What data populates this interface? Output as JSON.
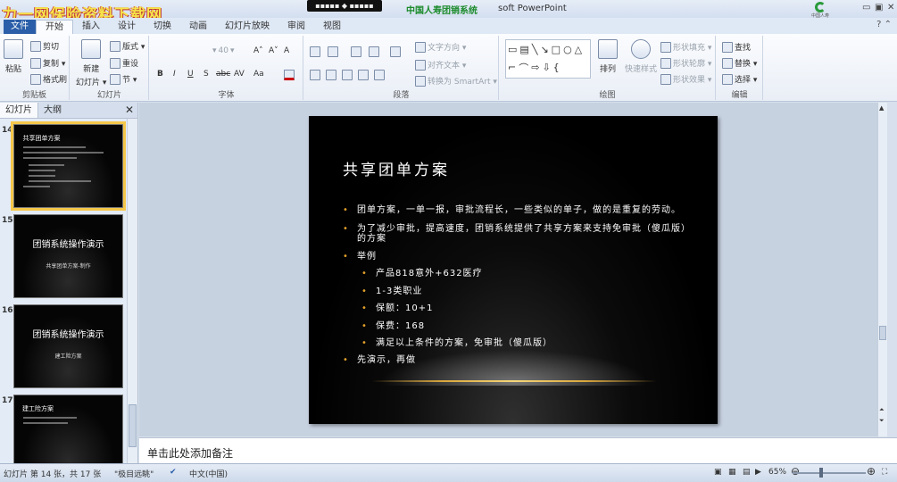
{
  "window": {
    "watermark": "力一网保险资料下载网",
    "logo_box": "▪▪▪▪▪ ◆ ▪▪▪▪▪",
    "title_green": "中国人寿团销系统",
    "title_suffix": "soft PowerPoint",
    "brand_text": "中国人寿",
    "minimize": "▭",
    "restore": "▣",
    "close": "✕",
    "help": "? ⌃"
  },
  "ribbon_tabs": [
    "文件",
    "开始",
    "插入",
    "设计",
    "切换",
    "动画",
    "幻灯片放映",
    "审阅",
    "视图"
  ],
  "ribbon": {
    "clipboard": {
      "paste": "粘贴",
      "cut": "剪切",
      "copy": "复制 ▾",
      "format_painter": "格式刷",
      "label": "剪贴板"
    },
    "slides": {
      "new_slide": "新建",
      "new_slide2": "幻灯片 ▾",
      "layout": "版式 ▾",
      "reset": "重设",
      "section": "节 ▾",
      "label": "幻灯片"
    },
    "font": {
      "size": "40",
      "bold": "B",
      "italic": "I",
      "underline": "U",
      "shadow": "S",
      "strike": "abc",
      "spacing": "AV",
      "case": "Aa",
      "grow": "A˄",
      "shrink": "A˅",
      "clear": "A",
      "label": "字体"
    },
    "paragraph": {
      "text_direction": "文字方向 ▾",
      "align_text": "对齐文本 ▾",
      "smartart": "转换为 SmartArt ▾",
      "label": "段落"
    },
    "drawing": {
      "arrange": "排列",
      "quick_styles": "快速样式",
      "shape_fill": "形状填充 ▾",
      "shape_outline": "形状轮廓 ▾",
      "shape_effects": "形状效果 ▾",
      "label": "绘图"
    },
    "editing": {
      "find": "查找",
      "replace": "替换 ▾",
      "select": "选择 ▾",
      "label": "编辑"
    }
  },
  "left_panel": {
    "tabs": [
      "幻灯片",
      "大纲"
    ],
    "close": "✕",
    "thumbnails": [
      {
        "num": "14",
        "title": "共享团单方案",
        "sub": ""
      },
      {
        "num": "15",
        "title": "团销系统操作演示",
        "sub": "共享团单方案-制作"
      },
      {
        "num": "16",
        "title": "团销系统操作演示",
        "sub": "建工险方案"
      },
      {
        "num": "17",
        "title": "建工险方案",
        "sub": ""
      }
    ]
  },
  "slide": {
    "title": "共享团单方案",
    "bullets": [
      {
        "text": "团单方案，一单一报，审批流程长，一些类似的单子，做的是重复的劳动。",
        "level": 1
      },
      {
        "text": "为了减少审批，提高速度，团销系统提供了共享方案来支持免审批（傻瓜版）",
        "level": 1
      },
      {
        "text": "的方案",
        "level": 0
      },
      {
        "text": "举例",
        "level": 1
      },
      {
        "text": "产品818意外+632医疗",
        "level": 2
      },
      {
        "text": "1-3类职业",
        "level": 2
      },
      {
        "text": "保额：10+1",
        "level": 2
      },
      {
        "text": "保费：168",
        "level": 2
      },
      {
        "text": "满足以上条件的方案，免审批（傻瓜版）",
        "level": 2
      },
      {
        "text": "先演示，再做",
        "level": 1
      }
    ]
  },
  "notes": {
    "placeholder": "单击此处添加备注"
  },
  "status": {
    "slide_info": "幻灯片 第 14 张，共 17 张",
    "theme": "\"极目远眺\"",
    "language": "中文(中国)",
    "zoom": "65%"
  },
  "colors": {
    "bullet": "#e3a12a",
    "file_tab": "#2a5ea8",
    "thumb_selected": "#f5c84a"
  }
}
